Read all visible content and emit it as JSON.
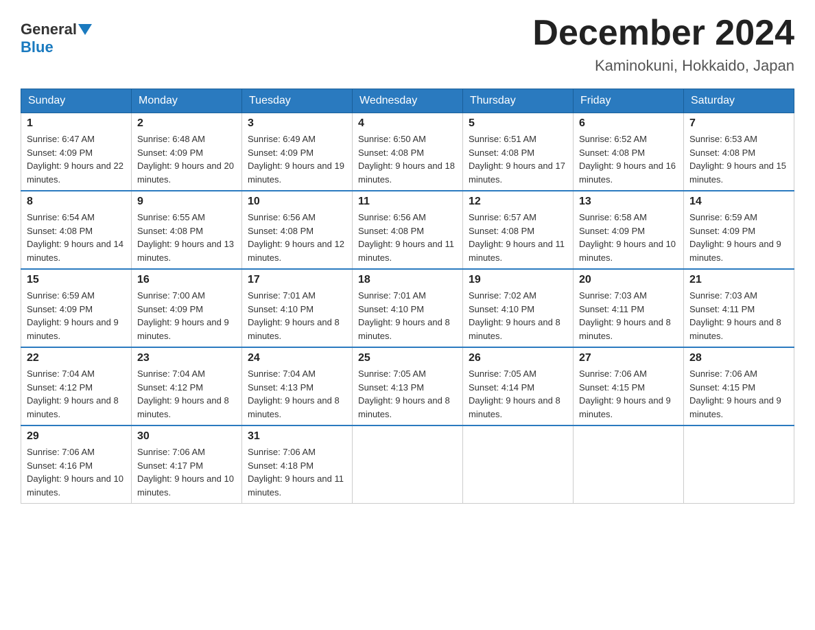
{
  "header": {
    "logo_general": "General",
    "logo_blue": "Blue",
    "month_title": "December 2024",
    "location": "Kaminokuni, Hokkaido, Japan"
  },
  "weekdays": [
    "Sunday",
    "Monday",
    "Tuesday",
    "Wednesday",
    "Thursday",
    "Friday",
    "Saturday"
  ],
  "weeks": [
    [
      {
        "day": "1",
        "sunrise": "6:47 AM",
        "sunset": "4:09 PM",
        "daylight": "9 hours and 22 minutes."
      },
      {
        "day": "2",
        "sunrise": "6:48 AM",
        "sunset": "4:09 PM",
        "daylight": "9 hours and 20 minutes."
      },
      {
        "day": "3",
        "sunrise": "6:49 AM",
        "sunset": "4:09 PM",
        "daylight": "9 hours and 19 minutes."
      },
      {
        "day": "4",
        "sunrise": "6:50 AM",
        "sunset": "4:08 PM",
        "daylight": "9 hours and 18 minutes."
      },
      {
        "day": "5",
        "sunrise": "6:51 AM",
        "sunset": "4:08 PM",
        "daylight": "9 hours and 17 minutes."
      },
      {
        "day": "6",
        "sunrise": "6:52 AM",
        "sunset": "4:08 PM",
        "daylight": "9 hours and 16 minutes."
      },
      {
        "day": "7",
        "sunrise": "6:53 AM",
        "sunset": "4:08 PM",
        "daylight": "9 hours and 15 minutes."
      }
    ],
    [
      {
        "day": "8",
        "sunrise": "6:54 AM",
        "sunset": "4:08 PM",
        "daylight": "9 hours and 14 minutes."
      },
      {
        "day": "9",
        "sunrise": "6:55 AM",
        "sunset": "4:08 PM",
        "daylight": "9 hours and 13 minutes."
      },
      {
        "day": "10",
        "sunrise": "6:56 AM",
        "sunset": "4:08 PM",
        "daylight": "9 hours and 12 minutes."
      },
      {
        "day": "11",
        "sunrise": "6:56 AM",
        "sunset": "4:08 PM",
        "daylight": "9 hours and 11 minutes."
      },
      {
        "day": "12",
        "sunrise": "6:57 AM",
        "sunset": "4:08 PM",
        "daylight": "9 hours and 11 minutes."
      },
      {
        "day": "13",
        "sunrise": "6:58 AM",
        "sunset": "4:09 PM",
        "daylight": "9 hours and 10 minutes."
      },
      {
        "day": "14",
        "sunrise": "6:59 AM",
        "sunset": "4:09 PM",
        "daylight": "9 hours and 9 minutes."
      }
    ],
    [
      {
        "day": "15",
        "sunrise": "6:59 AM",
        "sunset": "4:09 PM",
        "daylight": "9 hours and 9 minutes."
      },
      {
        "day": "16",
        "sunrise": "7:00 AM",
        "sunset": "4:09 PM",
        "daylight": "9 hours and 9 minutes."
      },
      {
        "day": "17",
        "sunrise": "7:01 AM",
        "sunset": "4:10 PM",
        "daylight": "9 hours and 8 minutes."
      },
      {
        "day": "18",
        "sunrise": "7:01 AM",
        "sunset": "4:10 PM",
        "daylight": "9 hours and 8 minutes."
      },
      {
        "day": "19",
        "sunrise": "7:02 AM",
        "sunset": "4:10 PM",
        "daylight": "9 hours and 8 minutes."
      },
      {
        "day": "20",
        "sunrise": "7:03 AM",
        "sunset": "4:11 PM",
        "daylight": "9 hours and 8 minutes."
      },
      {
        "day": "21",
        "sunrise": "7:03 AM",
        "sunset": "4:11 PM",
        "daylight": "9 hours and 8 minutes."
      }
    ],
    [
      {
        "day": "22",
        "sunrise": "7:04 AM",
        "sunset": "4:12 PM",
        "daylight": "9 hours and 8 minutes."
      },
      {
        "day": "23",
        "sunrise": "7:04 AM",
        "sunset": "4:12 PM",
        "daylight": "9 hours and 8 minutes."
      },
      {
        "day": "24",
        "sunrise": "7:04 AM",
        "sunset": "4:13 PM",
        "daylight": "9 hours and 8 minutes."
      },
      {
        "day": "25",
        "sunrise": "7:05 AM",
        "sunset": "4:13 PM",
        "daylight": "9 hours and 8 minutes."
      },
      {
        "day": "26",
        "sunrise": "7:05 AM",
        "sunset": "4:14 PM",
        "daylight": "9 hours and 8 minutes."
      },
      {
        "day": "27",
        "sunrise": "7:06 AM",
        "sunset": "4:15 PM",
        "daylight": "9 hours and 9 minutes."
      },
      {
        "day": "28",
        "sunrise": "7:06 AM",
        "sunset": "4:15 PM",
        "daylight": "9 hours and 9 minutes."
      }
    ],
    [
      {
        "day": "29",
        "sunrise": "7:06 AM",
        "sunset": "4:16 PM",
        "daylight": "9 hours and 10 minutes."
      },
      {
        "day": "30",
        "sunrise": "7:06 AM",
        "sunset": "4:17 PM",
        "daylight": "9 hours and 10 minutes."
      },
      {
        "day": "31",
        "sunrise": "7:06 AM",
        "sunset": "4:18 PM",
        "daylight": "9 hours and 11 minutes."
      },
      null,
      null,
      null,
      null
    ]
  ]
}
